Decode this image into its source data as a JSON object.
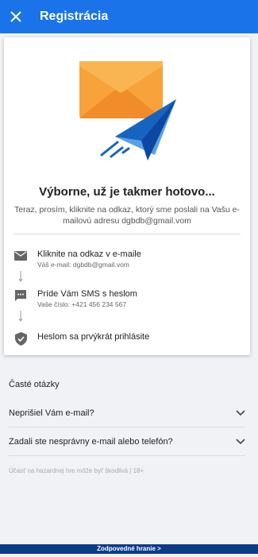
{
  "appbar": {
    "title": "Registrácia"
  },
  "card": {
    "headline": "Výborne, už je takmer hotovo...",
    "subtext": "Teraz, prosím, kliknite na odkaz, ktorý sme poslali na Vašu e-mailovú adresu dgbdb@gmail.vom",
    "steps": [
      {
        "title": "Kliknite na odkaz v e-maile",
        "subtitle": "Váš e-mail: dgbdb@gmail.vom",
        "icon": "envelope-icon"
      },
      {
        "title": "Príde Vám SMS s heslom",
        "subtitle": "Vaše číslo: +421 456 234 567",
        "icon": "sms-icon"
      },
      {
        "title": "Heslom sa prvýkrát prihlásite",
        "subtitle": "",
        "icon": "shield-check-icon"
      }
    ]
  },
  "faq": {
    "title": "Časté otázky",
    "items": [
      {
        "question": "Neprišiel Vám e-mail?"
      },
      {
        "question": "Zadali ste nesprávny e-mail alebo telefón?"
      }
    ]
  },
  "footer_note": "Účasť na hazardnej hre môže byť škodlivá | 18+",
  "bottom_bar": {
    "label": "Zodpovedné hranie >"
  },
  "colors": {
    "primary": "#1a73e8",
    "bottom_bar": "#0b3b8a",
    "envelope": "#f7a23b",
    "plane": "#1565c0"
  }
}
